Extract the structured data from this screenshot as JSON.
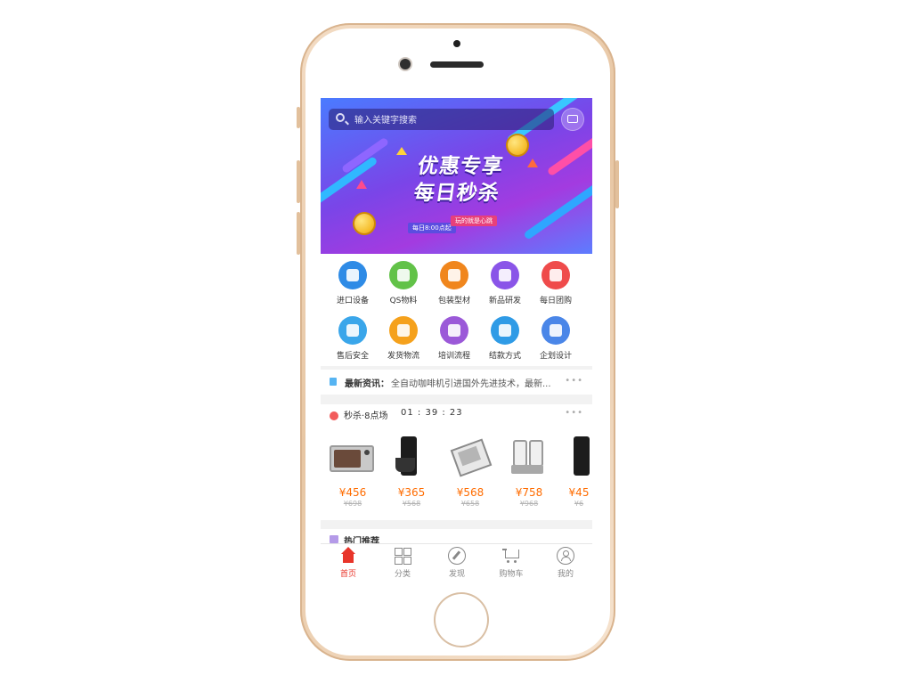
{
  "search": {
    "placeholder": "输入关键字搜索"
  },
  "banner": {
    "title_line1": "优惠专享",
    "title_line2": "每日秒杀",
    "tag_time": "每日8:00点起",
    "tag_slogan": "玩的就是心跳"
  },
  "categories": [
    {
      "label": "进口设备",
      "icon": "globe-icon",
      "color": "#2e8be6"
    },
    {
      "label": "QS物料",
      "icon": "leaf-icon",
      "color": "#62c248"
    },
    {
      "label": "包装型材",
      "icon": "box-icon",
      "color": "#f0861d"
    },
    {
      "label": "新品研发",
      "icon": "bulb-icon",
      "color": "#8a55e8"
    },
    {
      "label": "每日团购",
      "icon": "tag-icon",
      "color": "#ef4b4b"
    },
    {
      "label": "售后安全",
      "icon": "shield-icon",
      "color": "#3aa6ea"
    },
    {
      "label": "发货物流",
      "icon": "rocket-icon",
      "color": "#f5a11c"
    },
    {
      "label": "培训流程",
      "icon": "graduation-icon",
      "color": "#9b59d8"
    },
    {
      "label": "结款方式",
      "icon": "chart-icon",
      "color": "#2f9be6"
    },
    {
      "label": "企划设计",
      "icon": "book-icon",
      "color": "#4a86e8"
    }
  ],
  "news": {
    "label": "最新资讯：",
    "text": "全自动咖啡机引进国外先进技术，最新...",
    "more": "•••"
  },
  "flash_sale": {
    "title": "秒杀·8点场",
    "time": "01 : 39 : 23",
    "more": "•••",
    "products": [
      {
        "name": "toaster-oven",
        "price": "¥456",
        "old_price": "¥698"
      },
      {
        "name": "coffee-maker",
        "price": "¥365",
        "old_price": "¥568"
      },
      {
        "name": "tray-rack",
        "price": "¥568",
        "old_price": "¥658"
      },
      {
        "name": "juice-dispenser",
        "price": "¥758",
        "old_price": "¥968"
      },
      {
        "name": "coffee-maker-2",
        "price": "¥45",
        "old_price": "¥6"
      }
    ]
  },
  "hot": {
    "title": "热门推荐"
  },
  "tabs": [
    {
      "label": "首页",
      "icon": "home-icon",
      "active": true
    },
    {
      "label": "分类",
      "icon": "grid-icon",
      "active": false
    },
    {
      "label": "发现",
      "icon": "compass-icon",
      "active": false
    },
    {
      "label": "购物车",
      "icon": "cart-icon",
      "active": false
    },
    {
      "label": "我的",
      "icon": "user-icon",
      "active": false
    }
  ],
  "colors": {
    "accent_red": "#e8352a",
    "price_orange": "#ff6c00"
  }
}
